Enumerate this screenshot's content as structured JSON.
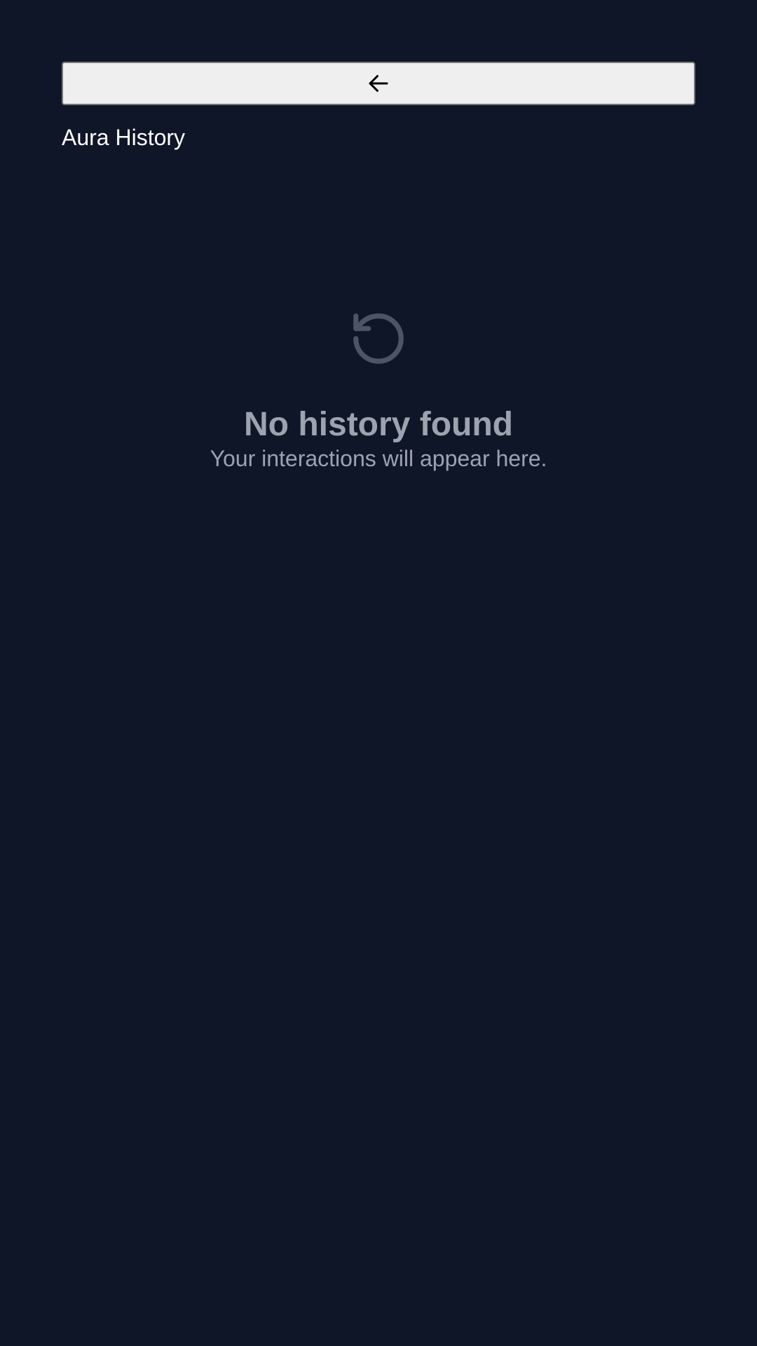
{
  "header": {
    "back_icon": "arrow-left-icon",
    "title": "Aura History"
  },
  "empty_state": {
    "icon": "history-icon",
    "title": "No history found",
    "subtitle": "Your interactions will appear here."
  },
  "colors": {
    "background": "#0f1628",
    "button_bg": "#efefef",
    "muted_text": "#9ca3af",
    "icon_muted": "#4b5563",
    "title_text": "#ffffff"
  }
}
